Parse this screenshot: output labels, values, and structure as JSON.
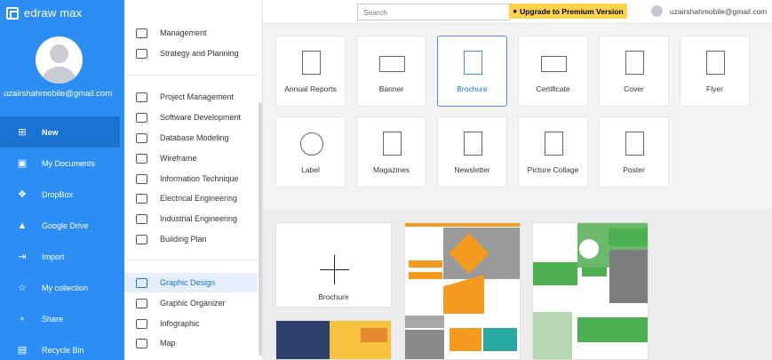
{
  "app": {
    "brand": "edraw max"
  },
  "sidebar": {
    "email": "uzairshahmobile@gmail.com",
    "items": [
      {
        "label": "New",
        "icon": "new-file-icon",
        "active": true
      },
      {
        "label": "My Documents",
        "icon": "documents-icon",
        "active": false
      },
      {
        "label": "DropBox",
        "icon": "dropbox-icon",
        "active": false
      },
      {
        "label": "Google Drive",
        "icon": "google-drive-icon",
        "active": false
      },
      {
        "label": "Import",
        "icon": "import-icon",
        "active": false
      },
      {
        "label": "My collection",
        "icon": "star-icon",
        "active": false
      },
      {
        "label": "Share",
        "icon": "share-icon",
        "active": false
      },
      {
        "label": "Recycle Bin",
        "icon": "trash-icon",
        "active": false
      }
    ]
  },
  "categories": [
    {
      "label": "Management",
      "icon": "management-icon"
    },
    {
      "label": "Strategy and Planning",
      "icon": "strategy-icon"
    },
    {
      "label": "Project Management",
      "icon": "project-management-icon"
    },
    {
      "label": "Software Development",
      "icon": "software-icon"
    },
    {
      "label": "Database Modeling",
      "icon": "database-icon"
    },
    {
      "label": "Wireframe",
      "icon": "wireframe-icon"
    },
    {
      "label": "Information Technique",
      "icon": "information-icon"
    },
    {
      "label": "Electrical Engineering",
      "icon": "electrical-icon"
    },
    {
      "label": "Industrial Engineering",
      "icon": "industrial-icon"
    },
    {
      "label": "Building Plan",
      "icon": "building-plan-icon"
    },
    {
      "label": "Graphic Design",
      "icon": "graphic-design-icon",
      "active": true
    },
    {
      "label": "Graphic Organizer",
      "icon": "organizer-icon"
    },
    {
      "label": "Infographic",
      "icon": "infographic-icon"
    },
    {
      "label": "Map",
      "icon": "map-icon"
    }
  ],
  "topbar": {
    "search_placeholder": "Search",
    "upgrade_label": "Upgrade to Premium Version",
    "user_email": "uzairshahmobile@gmail.com"
  },
  "template_types": [
    {
      "label": "Annual Reports",
      "icon": "annual-report-icon"
    },
    {
      "label": "Banner",
      "icon": "banner-icon"
    },
    {
      "label": "Brochure",
      "icon": "brochure-icon",
      "selected": true
    },
    {
      "label": "Certificate",
      "icon": "certificate-icon"
    },
    {
      "label": "Cover",
      "icon": "cover-icon"
    },
    {
      "label": "Flyer",
      "icon": "flyer-icon"
    },
    {
      "label": "Label",
      "icon": "label-icon"
    },
    {
      "label": "Magazines",
      "icon": "magazine-icon"
    },
    {
      "label": "Newsletter",
      "icon": "newsletter-icon"
    },
    {
      "label": "Picture Collage",
      "icon": "collage-icon"
    },
    {
      "label": "Poster",
      "icon": "poster-icon"
    }
  ],
  "templates": {
    "blank_label": "Brochure"
  },
  "colors": {
    "sidebar": "#2c8ef5",
    "sidebar_active": "#1a73d1",
    "upgrade": "#ffd24a",
    "accent_orange": "#f39a1f",
    "accent_green": "#4caf50"
  }
}
